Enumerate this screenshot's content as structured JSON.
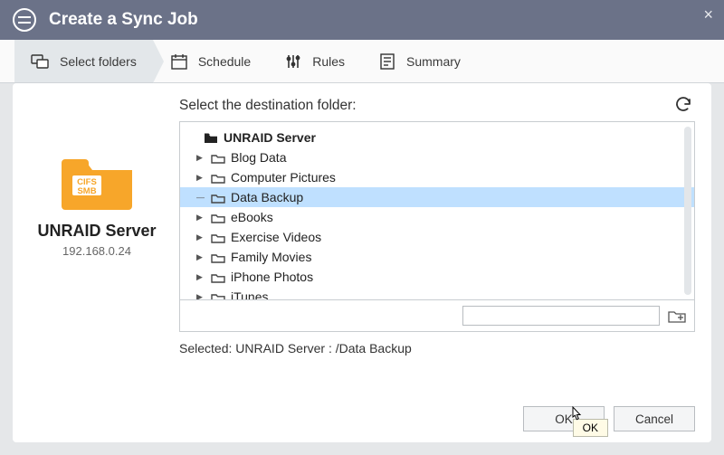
{
  "header": {
    "title": "Create a Sync Job",
    "close": "×"
  },
  "steps": {
    "folders": "Select folders",
    "schedule": "Schedule",
    "rules": "Rules",
    "summary": "Summary"
  },
  "server": {
    "badge": "CIFS\nSMB",
    "name": "UNRAID Server",
    "ip": "192.168.0.24"
  },
  "panel": {
    "prompt": "Select the destination folder:",
    "refresh_icon": "↻",
    "root": "UNRAID Server",
    "folders": [
      {
        "name": "Blog Data",
        "expandable": true,
        "selected": false
      },
      {
        "name": "Computer Pictures",
        "expandable": true,
        "selected": false
      },
      {
        "name": "Data Backup",
        "expandable": false,
        "selected": true
      },
      {
        "name": "eBooks",
        "expandable": true,
        "selected": false
      },
      {
        "name": "Exercise Videos",
        "expandable": true,
        "selected": false
      },
      {
        "name": "Family Movies",
        "expandable": true,
        "selected": false
      },
      {
        "name": "iPhone Photos",
        "expandable": true,
        "selected": false
      },
      {
        "name": "iTunes",
        "expandable": true,
        "selected": false
      }
    ],
    "path_value": "",
    "newfolder": "⊕",
    "selected_label": "Selected:",
    "selected_value": "UNRAID Server : /Data Backup"
  },
  "buttons": {
    "ok": "OK",
    "cancel": "Cancel",
    "tooltip": "OK"
  }
}
